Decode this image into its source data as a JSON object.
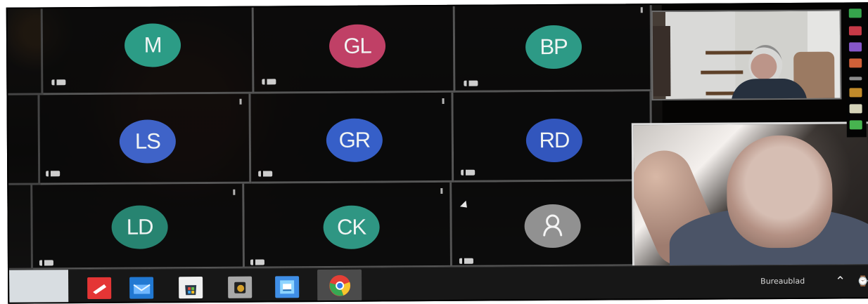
{
  "participants": [
    {
      "initials": "M",
      "color": "#2c9c86"
    },
    {
      "initials": "GL",
      "color": "#c04066"
    },
    {
      "initials": "BP",
      "color": "#2d9a86"
    },
    {
      "initials": "LS",
      "color": "#3f63c8"
    },
    {
      "initials": "GR",
      "color": "#365fc8"
    },
    {
      "initials": "RD",
      "color": "#3256bd"
    },
    {
      "initials": "LD",
      "color": "#278471"
    },
    {
      "initials": "CK",
      "color": "#2f9683"
    },
    {
      "initials": "",
      "color": "#8f8f8f"
    }
  ],
  "taskbar": {
    "label": "Bureaublad"
  },
  "icons": {
    "mic": "mic-icon",
    "person": "person-icon",
    "chrome": "chrome-icon",
    "mail": "mail-icon",
    "store": "store-icon",
    "folder": "folder-icon",
    "app": "app-icon",
    "chevron": "chevron-up-icon"
  }
}
